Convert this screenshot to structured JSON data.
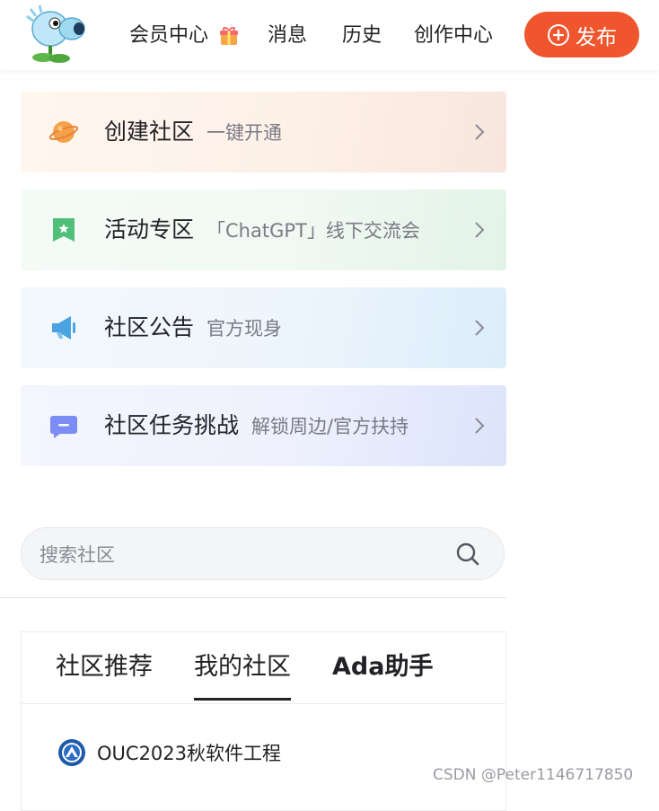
{
  "header": {
    "nav": [
      {
        "label": "会员中心"
      },
      {
        "label": "消息"
      },
      {
        "label": "历史"
      },
      {
        "label": "创作中心"
      }
    ],
    "publish_label": "发布"
  },
  "cards": [
    {
      "title": "创建社区",
      "subtitle": "一键开通",
      "icon": "planet-icon"
    },
    {
      "title": "活动专区",
      "subtitle": "「ChatGPT」线下交流会",
      "icon": "flag-icon"
    },
    {
      "title": "社区公告",
      "subtitle": "官方现身",
      "icon": "megaphone-icon"
    },
    {
      "title": "社区任务挑战",
      "subtitle": "解锁周边/官方扶持",
      "icon": "message-icon"
    }
  ],
  "search": {
    "placeholder": "搜索社区",
    "value": ""
  },
  "tabs": [
    {
      "label": "社区推荐"
    },
    {
      "label": "我的社区"
    },
    {
      "label": "Ada助手"
    }
  ],
  "communities": [
    {
      "name": "OUC2023秋软件工程"
    }
  ],
  "watermark": "CSDN @Peter1146717850",
  "colors": {
    "accent": "#f0562d",
    "text": "#222226",
    "muted": "#7a7a85"
  }
}
